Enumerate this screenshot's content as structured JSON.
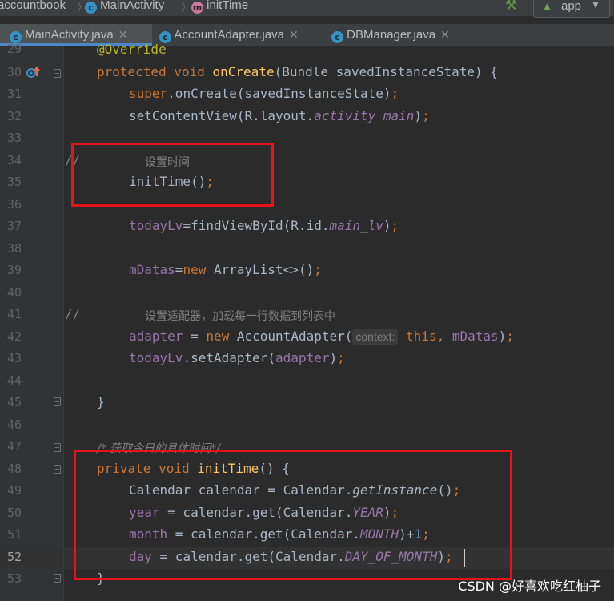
{
  "breadcrumb": {
    "project": "accountbook",
    "class_name": "MainActivity",
    "method_name": "initTime"
  },
  "run_config": {
    "label": "app"
  },
  "tabs": [
    {
      "label": "MainActivity.java",
      "active": true
    },
    {
      "label": "AccountAdapter.java",
      "active": false
    },
    {
      "label": "DBManager.java",
      "active": false
    }
  ],
  "editor": {
    "line_numbers": [
      "29",
      "30",
      "31",
      "32",
      "33",
      "34",
      "35",
      "36",
      "37",
      "38",
      "39",
      "40",
      "41",
      "42",
      "43",
      "44",
      "45",
      "46",
      "47",
      "48",
      "49",
      "50",
      "51",
      "52",
      "53"
    ],
    "current_line": "52",
    "code": {
      "l29_annotation": "@Override",
      "l30_kw1": "protected",
      "l30_kw2": "void",
      "l30_method": "onCreate",
      "l30_params": "(Bundle savedInstanceState) {",
      "l31_super": "super",
      "l31_rest": ".onCreate(savedInstanceState)",
      "l31_semi": ";",
      "l32_pre": "setContentView(R.layout.",
      "l32_field": "activity_main",
      "l32_post": ")",
      "l32_semi": ";",
      "l34_slashes": "//",
      "l34_comment": "设置时间",
      "l35_call": "initTime()",
      "l35_semi": ";",
      "l37_field": "todayLv",
      "l37_pre": "=findViewById(R.id.",
      "l37_id": "main_lv",
      "l37_post": ")",
      "l37_semi": ";",
      "l39_field": "mDatas",
      "l39_eq": "=",
      "l39_new": "new",
      "l39_rest": " ArrayList<>()",
      "l39_semi": ";",
      "l41_slashes": "//",
      "l41_comment": "设置适配器，加载每一行数据到列表中",
      "l42_field": "adapter",
      "l42_eq": " = ",
      "l42_new": "new",
      "l42_class": " AccountAdapter(",
      "l42_hint": "context:",
      "l42_this": "this",
      "l42_comma": ", ",
      "l42_arg": "mDatas",
      "l42_post": ")",
      "l42_semi": ";",
      "l43_field": "todayLv",
      "l43_mid": ".setAdapter(",
      "l43_arg": "adapter",
      "l43_post": ")",
      "l43_semi": ";",
      "l45_brace": "}",
      "l47_comment": "/* 获取今日的具体时间*/",
      "l48_kw1": "private",
      "l48_kw2": "void",
      "l48_method": "initTime",
      "l48_rest": "() {",
      "l49_pre": "Calendar calendar = Calendar.",
      "l49_static": "getInstance",
      "l49_post": "()",
      "l49_semi": ";",
      "l50_field": "year",
      "l50_mid": " = calendar.get(Calendar.",
      "l50_const": "YEAR",
      "l50_post": ")",
      "l50_semi": ";",
      "l51_field": "month",
      "l51_mid": " = calendar.get(Calendar.",
      "l51_const": "MONTH",
      "l51_post": ")+",
      "l51_num": "1",
      "l51_semi": ";",
      "l52_field": "day",
      "l52_mid": " = calendar.get(Calendar.",
      "l52_const": "DAY_OF_MONTH",
      "l52_post": ")",
      "l52_semi": ";",
      "l53_brace": "}"
    }
  },
  "watermark": "CSDN @好喜欢吃红柚子",
  "colors": {
    "keyword": "#cc7832",
    "method": "#ffc66d",
    "field": "#9876aa",
    "comment": "#808080",
    "annotation": "#bbb529",
    "highlight_box": "#e8121c"
  }
}
